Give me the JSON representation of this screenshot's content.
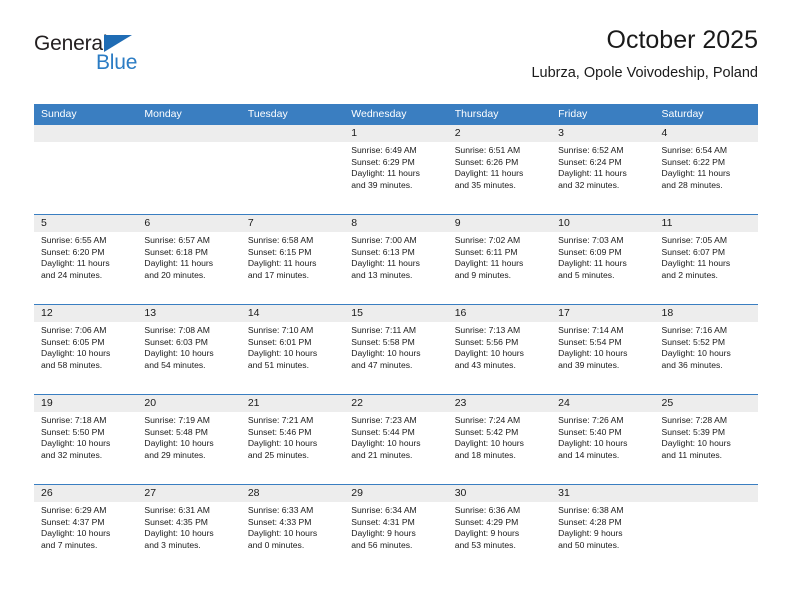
{
  "brand": {
    "name_part1": "General",
    "name_part2": "Blue",
    "accent_color": "#2b7cc4",
    "triangle_color": "#1f6cb4"
  },
  "header": {
    "title": "October 2025",
    "subtitle": "Lubrza, Opole Voivodeship, Poland"
  },
  "calendar": {
    "header_color": "#3a7ec1",
    "weekdays": [
      "Sunday",
      "Monday",
      "Tuesday",
      "Wednesday",
      "Thursday",
      "Friday",
      "Saturday"
    ],
    "weeks": [
      [
        {
          "day": "",
          "sunrise": "",
          "sunset": "",
          "daylight_line1": "",
          "daylight_line2": "",
          "empty": true
        },
        {
          "day": "",
          "sunrise": "",
          "sunset": "",
          "daylight_line1": "",
          "daylight_line2": "",
          "empty": true
        },
        {
          "day": "",
          "sunrise": "",
          "sunset": "",
          "daylight_line1": "",
          "daylight_line2": "",
          "empty": true
        },
        {
          "day": "1",
          "sunrise": "Sunrise: 6:49 AM",
          "sunset": "Sunset: 6:29 PM",
          "daylight_line1": "Daylight: 11 hours",
          "daylight_line2": "and 39 minutes."
        },
        {
          "day": "2",
          "sunrise": "Sunrise: 6:51 AM",
          "sunset": "Sunset: 6:26 PM",
          "daylight_line1": "Daylight: 11 hours",
          "daylight_line2": "and 35 minutes."
        },
        {
          "day": "3",
          "sunrise": "Sunrise: 6:52 AM",
          "sunset": "Sunset: 6:24 PM",
          "daylight_line1": "Daylight: 11 hours",
          "daylight_line2": "and 32 minutes."
        },
        {
          "day": "4",
          "sunrise": "Sunrise: 6:54 AM",
          "sunset": "Sunset: 6:22 PM",
          "daylight_line1": "Daylight: 11 hours",
          "daylight_line2": "and 28 minutes."
        }
      ],
      [
        {
          "day": "5",
          "sunrise": "Sunrise: 6:55 AM",
          "sunset": "Sunset: 6:20 PM",
          "daylight_line1": "Daylight: 11 hours",
          "daylight_line2": "and 24 minutes."
        },
        {
          "day": "6",
          "sunrise": "Sunrise: 6:57 AM",
          "sunset": "Sunset: 6:18 PM",
          "daylight_line1": "Daylight: 11 hours",
          "daylight_line2": "and 20 minutes."
        },
        {
          "day": "7",
          "sunrise": "Sunrise: 6:58 AM",
          "sunset": "Sunset: 6:15 PM",
          "daylight_line1": "Daylight: 11 hours",
          "daylight_line2": "and 17 minutes."
        },
        {
          "day": "8",
          "sunrise": "Sunrise: 7:00 AM",
          "sunset": "Sunset: 6:13 PM",
          "daylight_line1": "Daylight: 11 hours",
          "daylight_line2": "and 13 minutes."
        },
        {
          "day": "9",
          "sunrise": "Sunrise: 7:02 AM",
          "sunset": "Sunset: 6:11 PM",
          "daylight_line1": "Daylight: 11 hours",
          "daylight_line2": "and 9 minutes."
        },
        {
          "day": "10",
          "sunrise": "Sunrise: 7:03 AM",
          "sunset": "Sunset: 6:09 PM",
          "daylight_line1": "Daylight: 11 hours",
          "daylight_line2": "and 5 minutes."
        },
        {
          "day": "11",
          "sunrise": "Sunrise: 7:05 AM",
          "sunset": "Sunset: 6:07 PM",
          "daylight_line1": "Daylight: 11 hours",
          "daylight_line2": "and 2 minutes."
        }
      ],
      [
        {
          "day": "12",
          "sunrise": "Sunrise: 7:06 AM",
          "sunset": "Sunset: 6:05 PM",
          "daylight_line1": "Daylight: 10 hours",
          "daylight_line2": "and 58 minutes."
        },
        {
          "day": "13",
          "sunrise": "Sunrise: 7:08 AM",
          "sunset": "Sunset: 6:03 PM",
          "daylight_line1": "Daylight: 10 hours",
          "daylight_line2": "and 54 minutes."
        },
        {
          "day": "14",
          "sunrise": "Sunrise: 7:10 AM",
          "sunset": "Sunset: 6:01 PM",
          "daylight_line1": "Daylight: 10 hours",
          "daylight_line2": "and 51 minutes."
        },
        {
          "day": "15",
          "sunrise": "Sunrise: 7:11 AM",
          "sunset": "Sunset: 5:58 PM",
          "daylight_line1": "Daylight: 10 hours",
          "daylight_line2": "and 47 minutes."
        },
        {
          "day": "16",
          "sunrise": "Sunrise: 7:13 AM",
          "sunset": "Sunset: 5:56 PM",
          "daylight_line1": "Daylight: 10 hours",
          "daylight_line2": "and 43 minutes."
        },
        {
          "day": "17",
          "sunrise": "Sunrise: 7:14 AM",
          "sunset": "Sunset: 5:54 PM",
          "daylight_line1": "Daylight: 10 hours",
          "daylight_line2": "and 39 minutes."
        },
        {
          "day": "18",
          "sunrise": "Sunrise: 7:16 AM",
          "sunset": "Sunset: 5:52 PM",
          "daylight_line1": "Daylight: 10 hours",
          "daylight_line2": "and 36 minutes."
        }
      ],
      [
        {
          "day": "19",
          "sunrise": "Sunrise: 7:18 AM",
          "sunset": "Sunset: 5:50 PM",
          "daylight_line1": "Daylight: 10 hours",
          "daylight_line2": "and 32 minutes."
        },
        {
          "day": "20",
          "sunrise": "Sunrise: 7:19 AM",
          "sunset": "Sunset: 5:48 PM",
          "daylight_line1": "Daylight: 10 hours",
          "daylight_line2": "and 29 minutes."
        },
        {
          "day": "21",
          "sunrise": "Sunrise: 7:21 AM",
          "sunset": "Sunset: 5:46 PM",
          "daylight_line1": "Daylight: 10 hours",
          "daylight_line2": "and 25 minutes."
        },
        {
          "day": "22",
          "sunrise": "Sunrise: 7:23 AM",
          "sunset": "Sunset: 5:44 PM",
          "daylight_line1": "Daylight: 10 hours",
          "daylight_line2": "and 21 minutes."
        },
        {
          "day": "23",
          "sunrise": "Sunrise: 7:24 AM",
          "sunset": "Sunset: 5:42 PM",
          "daylight_line1": "Daylight: 10 hours",
          "daylight_line2": "and 18 minutes."
        },
        {
          "day": "24",
          "sunrise": "Sunrise: 7:26 AM",
          "sunset": "Sunset: 5:40 PM",
          "daylight_line1": "Daylight: 10 hours",
          "daylight_line2": "and 14 minutes."
        },
        {
          "day": "25",
          "sunrise": "Sunrise: 7:28 AM",
          "sunset": "Sunset: 5:39 PM",
          "daylight_line1": "Daylight: 10 hours",
          "daylight_line2": "and 11 minutes."
        }
      ],
      [
        {
          "day": "26",
          "sunrise": "Sunrise: 6:29 AM",
          "sunset": "Sunset: 4:37 PM",
          "daylight_line1": "Daylight: 10 hours",
          "daylight_line2": "and 7 minutes."
        },
        {
          "day": "27",
          "sunrise": "Sunrise: 6:31 AM",
          "sunset": "Sunset: 4:35 PM",
          "daylight_line1": "Daylight: 10 hours",
          "daylight_line2": "and 3 minutes."
        },
        {
          "day": "28",
          "sunrise": "Sunrise: 6:33 AM",
          "sunset": "Sunset: 4:33 PM",
          "daylight_line1": "Daylight: 10 hours",
          "daylight_line2": "and 0 minutes."
        },
        {
          "day": "29",
          "sunrise": "Sunrise: 6:34 AM",
          "sunset": "Sunset: 4:31 PM",
          "daylight_line1": "Daylight: 9 hours",
          "daylight_line2": "and 56 minutes."
        },
        {
          "day": "30",
          "sunrise": "Sunrise: 6:36 AM",
          "sunset": "Sunset: 4:29 PM",
          "daylight_line1": "Daylight: 9 hours",
          "daylight_line2": "and 53 minutes."
        },
        {
          "day": "31",
          "sunrise": "Sunrise: 6:38 AM",
          "sunset": "Sunset: 4:28 PM",
          "daylight_line1": "Daylight: 9 hours",
          "daylight_line2": "and 50 minutes."
        },
        {
          "day": "",
          "sunrise": "",
          "sunset": "",
          "daylight_line1": "",
          "daylight_line2": "",
          "empty": true
        }
      ]
    ]
  }
}
